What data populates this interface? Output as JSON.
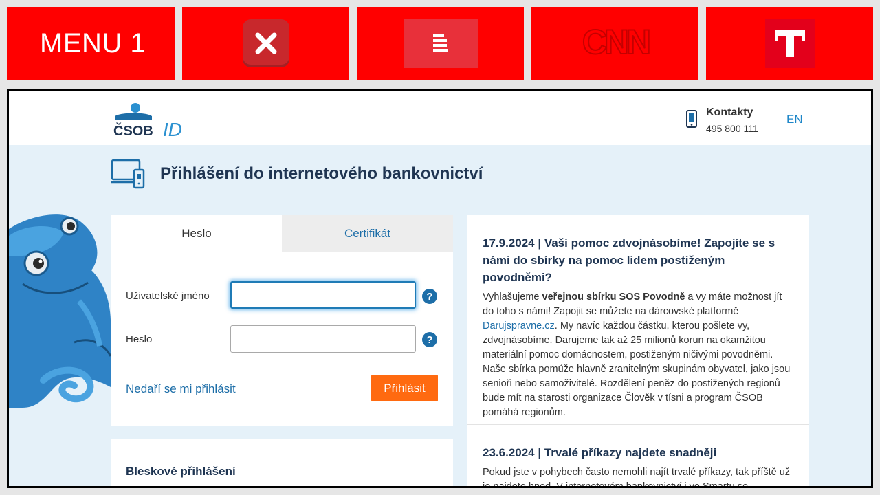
{
  "menubar": {
    "menu_label": "MENU 1",
    "tiles": [
      {
        "icon": "x-app-icon"
      },
      {
        "icon": "lines-app-icon"
      },
      {
        "icon": "cnn-logo"
      },
      {
        "icon": "t-logo"
      }
    ],
    "cnn_text": "CNN",
    "t_text": "T"
  },
  "header": {
    "brand": "ČSOB",
    "brand_suffix": "ID",
    "contact_title": "Kontakty",
    "contact_phone": "495 800 111",
    "lang": "EN"
  },
  "page": {
    "title": "Přihlášení do internetového bankovnictví"
  },
  "login": {
    "tabs": [
      {
        "label": "Heslo",
        "active": true
      },
      {
        "label": "Certifikát",
        "active": false
      }
    ],
    "username_label": "Uživatelské jméno",
    "username_value": "",
    "password_label": "Heslo",
    "password_value": "",
    "help_glyph": "?",
    "forgot_link": "Nedaří se mi přihlásit",
    "submit": "Přihlásit"
  },
  "quick_login": {
    "title": "Bleskové přihlášení"
  },
  "news": [
    {
      "title": "17.9.2024 | Vaši pomoc zdvojnásobíme! Zapojíte se s námi do sbírky na pomoc lidem postiženým povodněmi?",
      "body_pre": "Vyhlašujeme ",
      "body_bold": "veřejnou sbírku SOS Povodně",
      "body_mid": " a vy máte možnost jít do toho s námi! Zapojit se můžete na dárcovské platformě ",
      "body_link": "Darujspravne.cz",
      "body_post": ". My navíc každou částku, kterou pošlete vy, zdvojnásobíme. Darujeme tak až 25 milionů korun na okamžitou materiální pomoc domácnostem, postiženým ničivými povodněmi. Naše sbírka pomůže hlavně zranitelným skupinám obyvatel, jako jsou senioři nebo samoživitelé. Rozdělení peněz do postižených regionů bude mít na starosti organizace Člověk v tísni a program ČSOB pomáhá regionům."
    },
    {
      "title": "23.6.2024 | Trvalé příkazy najdete snadněji",
      "body": "Pokud jste v pohybech často nemohli najít trvalé příkazy, tak příště už je najdete hned. V internetovém bankovnictví i ve Smartu se"
    }
  ],
  "colors": {
    "menu_red": "#ff0000",
    "csob_blue": "#1d6ea8",
    "csob_navy": "#1f3552",
    "accent_orange": "#ff6a10",
    "page_bg": "#e5f1f9"
  }
}
